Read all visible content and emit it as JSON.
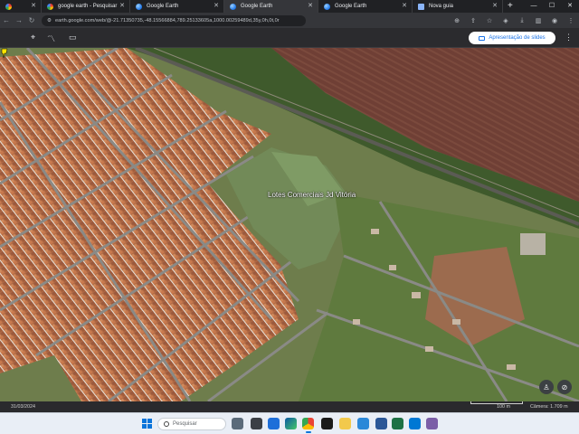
{
  "tabs": [
    {
      "label": "",
      "favicon": "google-icon"
    },
    {
      "label": "google earth - Pesquisar",
      "favicon": "google-icon"
    },
    {
      "label": "Google Earth",
      "favicon": "earth-icon"
    },
    {
      "label": "Google Earth",
      "favicon": "earth-icon"
    },
    {
      "label": "Google Earth",
      "favicon": "earth-icon"
    },
    {
      "label": "Nova guia",
      "favicon": "newtab-icon"
    }
  ],
  "new_tab_symbol": "+",
  "address": {
    "url": "earth.google.com/web/@-21.71350735,-48.15566884,789.25133605a,1000.00259489d,35y,0h,0t,0r"
  },
  "earth_toolbar": {
    "presentation_button": "Apresentação de slides"
  },
  "map": {
    "place_label": "Lotes Comerciais Jd Vitória"
  },
  "status": {
    "date": "31/03/2024",
    "scale_label": "100 m",
    "camera": "Câmera: 1.709 m"
  },
  "taskbar": {
    "search_placeholder": "Pesquisar"
  },
  "colors": {
    "accent": "#1a73e8",
    "tabstrip": "#202124",
    "addressbar": "#35363a"
  }
}
